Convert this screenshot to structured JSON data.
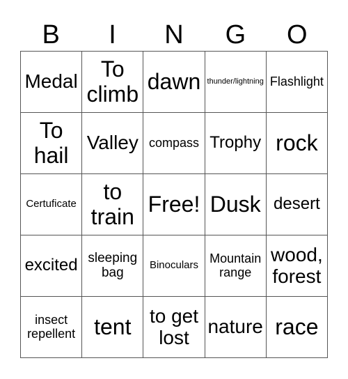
{
  "header": {
    "letters": [
      "B",
      "I",
      "N",
      "G",
      "O"
    ]
  },
  "cells": [
    [
      "Medal",
      "To climb",
      "dawn",
      "thunder/lightning",
      "Flashlight"
    ],
    [
      "To hail",
      "Valley",
      "compass",
      "Trophy",
      "rock"
    ],
    [
      "Certuficate",
      "to train",
      "Free!",
      "Dusk",
      "desert"
    ],
    [
      "excited",
      "sleeping bag",
      "Binoculars",
      "Mountain range",
      "wood, forest"
    ],
    [
      "insect repellent",
      "tent",
      "to get lost",
      "nature",
      "race"
    ]
  ]
}
